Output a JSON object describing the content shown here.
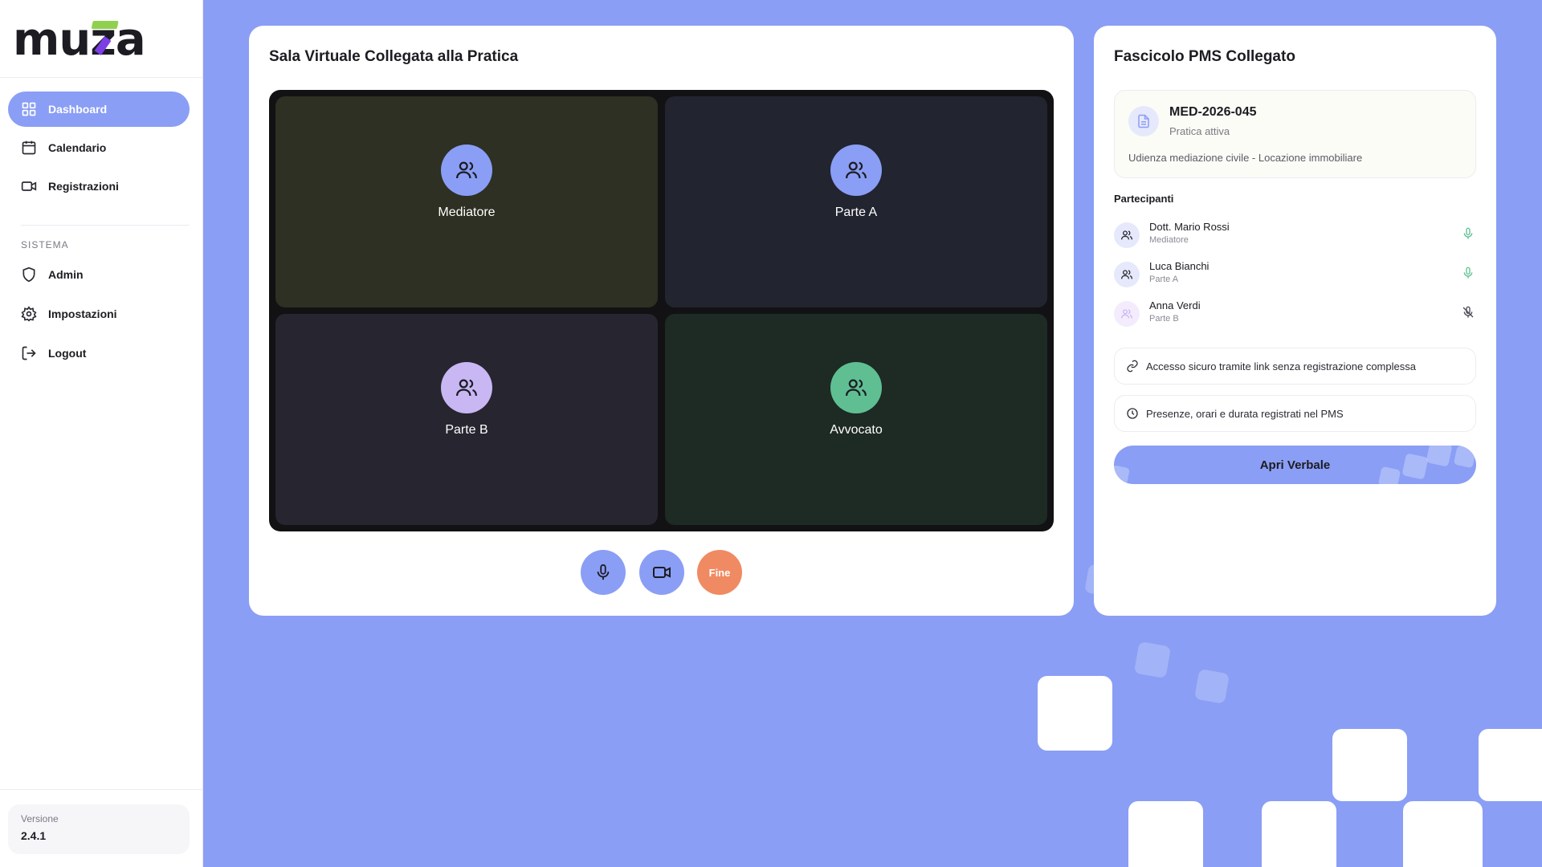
{
  "brand": {
    "name": "muza"
  },
  "sidebar": {
    "items": [
      {
        "label": "Dashboard",
        "icon": "grid-icon",
        "active": true
      },
      {
        "label": "Calendario",
        "icon": "calendar-icon"
      },
      {
        "label": "Registrazioni",
        "icon": "video-icon"
      }
    ],
    "section_label": "SISTEMA",
    "system_items": [
      {
        "label": "Admin",
        "icon": "shield-icon"
      },
      {
        "label": "Impostazioni",
        "icon": "gear-icon"
      },
      {
        "label": "Logout",
        "icon": "logout-icon"
      }
    ],
    "version": {
      "label": "Versione",
      "value": "2.4.1"
    }
  },
  "video_room": {
    "title": "Sala Virtuale Collegata alla Pratica",
    "tiles": [
      {
        "name": "Mediatore",
        "avatar_color": "#8a9ef5"
      },
      {
        "name": "Parte A",
        "avatar_color": "#8a9ef5"
      },
      {
        "name": "Parte B",
        "avatar_color": "#c9b7f4"
      },
      {
        "name": "Avvocato",
        "avatar_color": "#5fbf93"
      }
    ],
    "controls": {
      "end_label": "Fine"
    }
  },
  "case_file": {
    "title": "Fascicolo PMS Collegato",
    "case_id": "MED-2026-045",
    "status": "Pratica attiva",
    "description": "Udienza mediazione civile - Locazione immobiliare",
    "participants_title": "Partecipanti",
    "participants": [
      {
        "name": "Dott. Mario Rossi",
        "role": "Mediatore",
        "mic": "on"
      },
      {
        "name": "Luca Bianchi",
        "role": "Parte A",
        "mic": "on"
      },
      {
        "name": "Anna Verdi",
        "role": "Parte B",
        "mic": "off"
      }
    ],
    "info": [
      {
        "text": "Accesso sicuro tramite link senza registrazione complessa",
        "icon": "link-icon"
      },
      {
        "text": "Presenze, orari e durata registrati nel PMS",
        "icon": "clock-icon"
      }
    ],
    "primary_button": "Apri Verbale"
  },
  "colors": {
    "accent": "#8a9ef5",
    "end_call": "#f08a62",
    "mic_on": "#5fbf93",
    "logo_green": "#8fd14f",
    "logo_purple": "#7b3fe4"
  }
}
